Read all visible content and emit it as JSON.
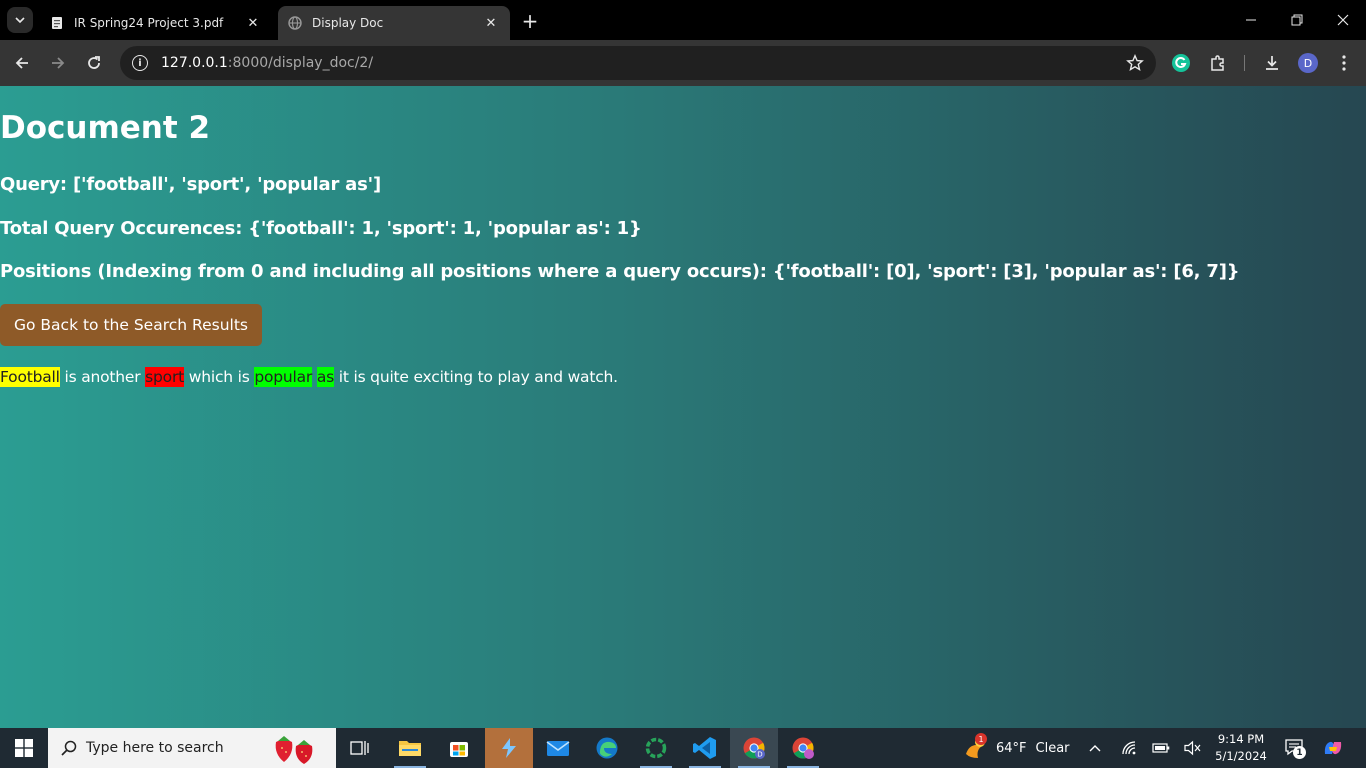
{
  "browser": {
    "tabs": [
      {
        "title": "IR Spring24 Project 3.pdf",
        "active": false
      },
      {
        "title": "Display Doc",
        "active": true
      }
    ],
    "url": {
      "host": "127.0.0.1",
      "path": ":8000/display_doc/2/"
    },
    "profile_initial": "D",
    "window_controls": {
      "minimize": "—",
      "restore": "❐",
      "close": "✕"
    }
  },
  "page": {
    "heading": "Document 2",
    "query_line": "Query: ['football', 'sport', 'popular as']",
    "occurrences_line": "Total Query Occurences: {'football': 1, 'sport': 1, 'popular as': 1}",
    "positions_line": "Positions (Indexing from 0 and including all positions where a query occurs): {'football': [0], 'sport': [3], 'popular as': [6, 7]}",
    "back_button_label": "Go Back to the Search Results",
    "document_text": {
      "w0": "Football",
      "t1": " is another ",
      "w1": "sport",
      "t2": " which is ",
      "w2": "popular",
      "t3": " ",
      "w3": "as",
      "t4": " it is quite exciting to play and watch."
    },
    "highlight_colors": {
      "football": "#ffff00",
      "sport": "#ff0000",
      "popular_as": "#00ff00"
    }
  },
  "taskbar": {
    "search_placeholder": "Type here to search",
    "weather": {
      "temp": "64°F",
      "condition": "Clear",
      "badge": "1"
    },
    "clock": {
      "time": "9:14 PM",
      "date": "5/1/2024"
    },
    "notification_count": "1"
  }
}
